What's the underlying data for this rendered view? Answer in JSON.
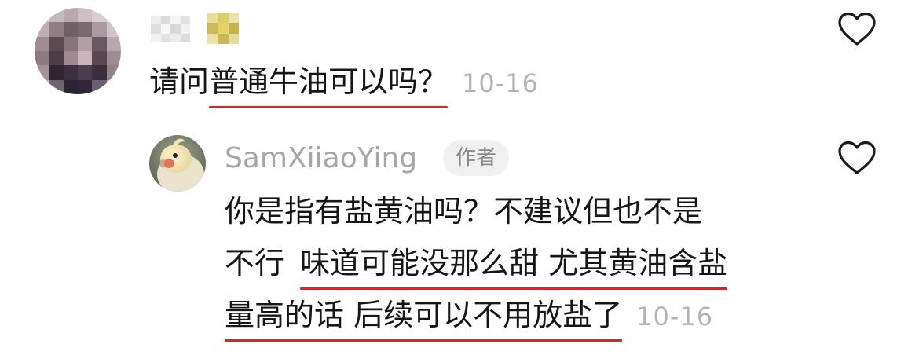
{
  "comment": {
    "text_before": "请问",
    "text_underlined": "普通牛油可以吗？",
    "time": "10-16",
    "like_icon": "heart-outline-icon"
  },
  "reply": {
    "author": "SamXiiaoYing",
    "author_badge": "作者",
    "line1": "你是指有盐黄油吗？不建议但也不是",
    "line2_plain": "不行",
    "line2_underlined": "味道可能没那么甜 尤其黄油含盐",
    "line3_underlined": "量高的话 后续可以不用放盐了",
    "time": "10-16",
    "like_icon": "heart-outline-icon"
  },
  "colors": {
    "underline": "#d8262c",
    "time_gray": "#b3b3b3",
    "name_gray": "#a6a6a6",
    "text": "#161616"
  }
}
